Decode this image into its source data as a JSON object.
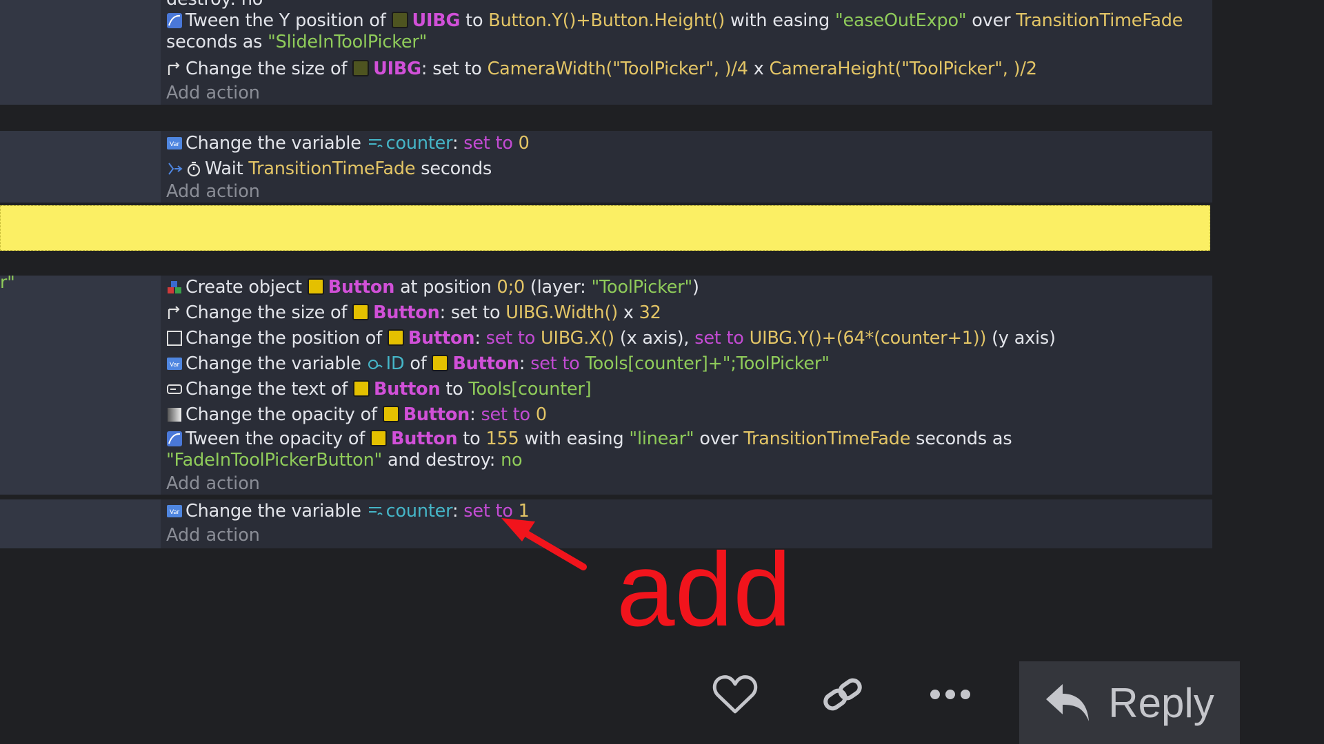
{
  "block1": {
    "cut_text": "destroy: no",
    "tween": {
      "pre": "Tween the Y position of ",
      "obj": "UIBG",
      "mid": " to ",
      "expr": "Button.Y()+Button.Height()",
      "mid2": " with easing ",
      "ease": "\"easeOutExpo\"",
      "mid3": " over ",
      "dur": "TransitionTimeFade",
      "post1": "seconds as ",
      "name": "\"SlideInToolPicker\""
    },
    "size": {
      "pre": "Change the size of ",
      "obj": "UIBG",
      "mid": ": set to ",
      "expr": "CameraWidth(\"ToolPicker\", )/4",
      "x": " x ",
      "expr2": "CameraHeight(\"ToolPicker\", )/2"
    },
    "add_action": "Add action"
  },
  "block2": {
    "var": {
      "pre": "Change the variable ",
      "name": "counter",
      "colon": ": ",
      "set": "set to",
      "val": "0"
    },
    "wait": {
      "pre": "Wait ",
      "dur": "TransitionTimeFade",
      "post": " seconds"
    },
    "add_action": "Add action"
  },
  "block3": {
    "cond_stub": "r\"",
    "create": {
      "pre": "Create object ",
      "obj": "Button",
      "mid": " at position ",
      "pos": "0;0",
      "mid2": " (layer: ",
      "layer": "\"ToolPicker\"",
      "post": ")"
    },
    "size": {
      "pre": "Change the size of ",
      "obj": "Button",
      "mid": ": set to ",
      "expr": "UIBG.Width()",
      "x": " x ",
      "val": "32"
    },
    "pos": {
      "pre": "Change the position of ",
      "obj": "Button",
      "colon": ": ",
      "set": "set to",
      "sp": " ",
      "xexpr": "UIBG.X()",
      "xaxis": " (x axis), ",
      "set2": "set to",
      "sp2": " ",
      "yexpr": "UIBG.Y()+(64*(counter+1))",
      "yaxis": " (y axis)"
    },
    "var": {
      "pre": "Change the variable ",
      "name": "ID",
      "of": " of ",
      "obj": "Button",
      "colon": ": ",
      "set": "set to",
      "sp": " ",
      "val": "Tools[counter]+\";ToolPicker\""
    },
    "text": {
      "pre": "Change the text of ",
      "obj": "Button",
      "mid": " to ",
      "val": "Tools[counter]"
    },
    "opacity": {
      "pre": "Change the opacity of ",
      "obj": "Button",
      "colon": ": ",
      "set": "set to",
      "sp": " ",
      "val": "0"
    },
    "tween": {
      "pre": "Tween the opacity of ",
      "obj": "Button",
      "mid": " to ",
      "val": "155",
      "mid2": " with easing ",
      "ease": "\"linear\"",
      "mid3": " over ",
      "dur": "TransitionTimeFade",
      "post1": " seconds as ",
      "name": "\"FadeInToolPickerButton\"",
      "post2": " and destroy: ",
      "destroy": "no"
    },
    "add_action": "Add action"
  },
  "block4": {
    "var": {
      "pre": "Change the variable ",
      "name": "counter",
      "colon": ": ",
      "set": "set to",
      "sp": " ",
      "val": "1"
    },
    "add_action": "Add action"
  },
  "annotation": {
    "text": "add",
    "color": "#f1141c"
  },
  "actions_bar": {
    "like_icon": "heart-icon",
    "link_icon": "link-icon",
    "more_icon": "ellipsis-icon",
    "reply_icon": "reply-arrow-icon",
    "reply_label": "Reply"
  },
  "colors": {
    "highlight": "#fbef64",
    "object": "#d150d8",
    "keyword": "#c34bd3",
    "number": "#e3c566",
    "string": "#8fcb5a",
    "variable": "#45b6c8"
  }
}
